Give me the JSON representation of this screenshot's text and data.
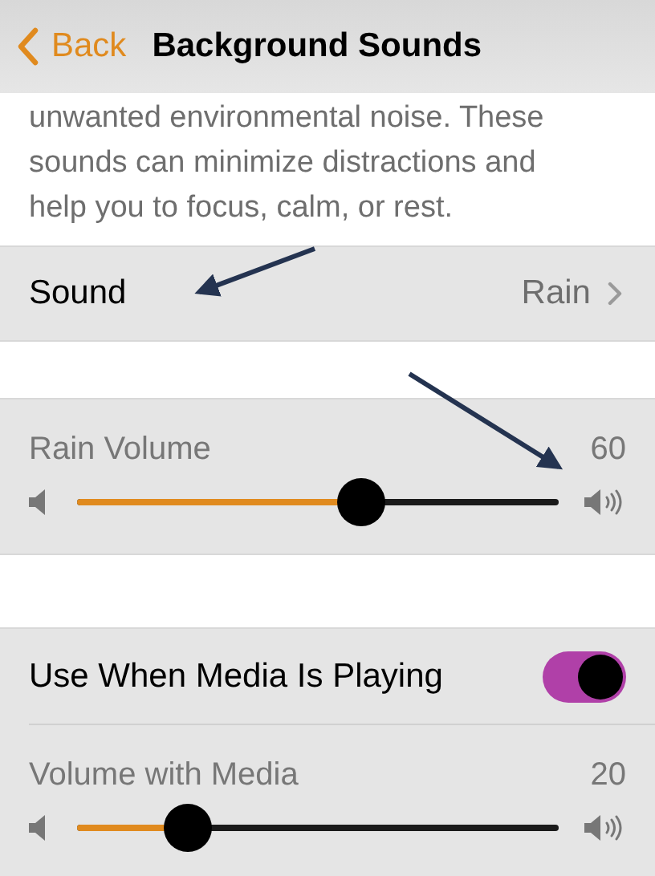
{
  "nav": {
    "back": "Back",
    "title": "Background Sounds"
  },
  "description": "unwanted environmental noise. These sounds can minimize distractions and help you to focus, calm, or rest.",
  "sound_row": {
    "label": "Sound",
    "value": "Rain"
  },
  "groups": [
    {
      "rows": [
        {
          "kind": "slider",
          "label": "Rain Volume",
          "reading": "60",
          "level": 0.6
        }
      ]
    },
    {
      "rows": [
        {
          "kind": "toggle",
          "label": "Use When Media Is Playing",
          "on": true
        },
        {
          "kind": "slider",
          "label": "Volume with Media",
          "reading": "20",
          "level": 0.2
        }
      ]
    }
  ]
}
